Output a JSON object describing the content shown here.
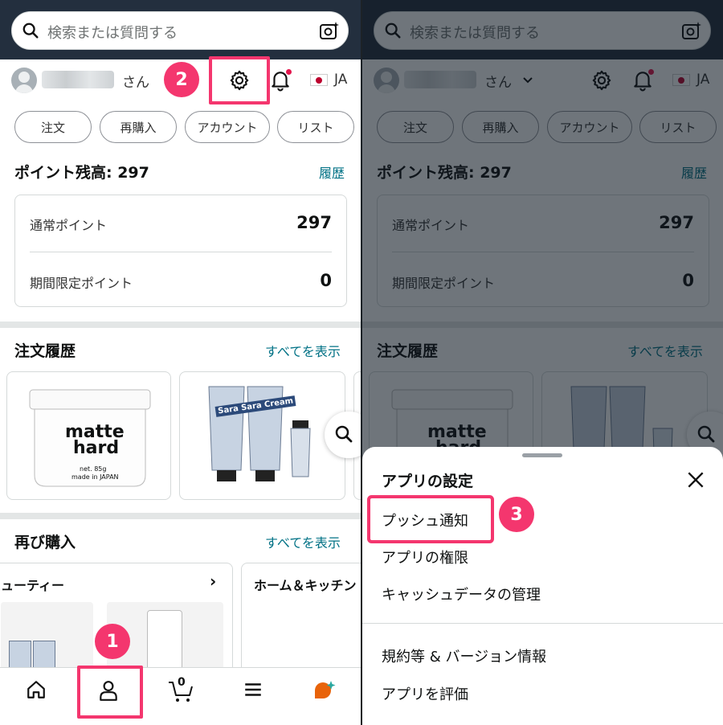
{
  "search": {
    "placeholder": "検索または質問する"
  },
  "user": {
    "honorific": "さん",
    "language": "JA"
  },
  "pills": [
    "注文",
    "再購入",
    "アカウント",
    "リスト"
  ],
  "points": {
    "title": "ポイント残高: 297",
    "history_link": "履歴",
    "rows": [
      {
        "label": "通常ポイント",
        "value": "297"
      },
      {
        "label": "期間限定ポイント",
        "value": "0"
      }
    ]
  },
  "orders": {
    "title": "注文履歴",
    "see_all": "すべてを表示"
  },
  "product1": {
    "line1": "matte",
    "line2": "hard",
    "small1": "net. 85g",
    "small2": "made in JAPAN"
  },
  "product2": {
    "brand": "Sara Sara Cream"
  },
  "rebuy": {
    "title": "再び購入",
    "see_all": "すべてを表示"
  },
  "categories": [
    {
      "label": "ューティー",
      "chevron": "›"
    },
    {
      "label": "ホーム＆キッチン"
    }
  ],
  "cart_count": "0",
  "steps": [
    "1",
    "2",
    "3"
  ],
  "settings_sheet": {
    "title": "アプリの設定",
    "items": [
      "プッシュ通知",
      "アプリの権限",
      "キャッシュデータの管理",
      "規約等 & バージョン情報",
      "アプリを評価"
    ]
  },
  "colors": {
    "accent": "#007185",
    "highlight": "#f4366e",
    "topbar": "#232f3e"
  },
  "icons": [
    "search-icon",
    "camera-icon",
    "gear-icon",
    "bell-icon",
    "home-icon",
    "user-icon",
    "cart-icon",
    "menu-icon",
    "rufus-icon",
    "close-icon"
  ]
}
